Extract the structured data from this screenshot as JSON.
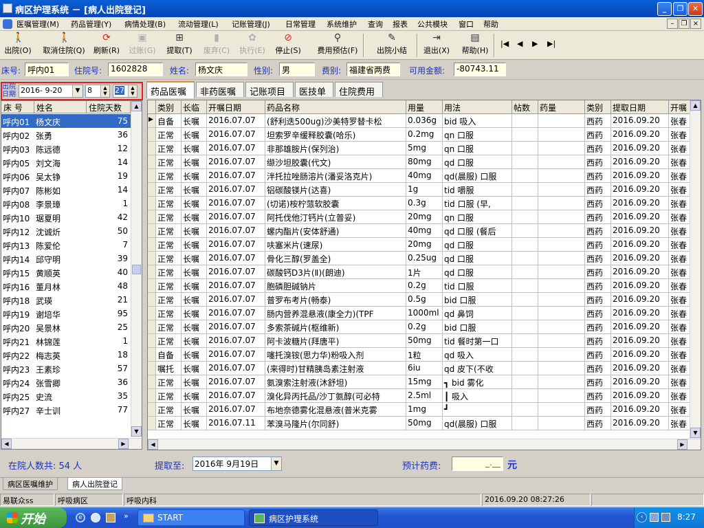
{
  "window": {
    "title": "病区护理系统 － [病人出院登记]",
    "min": "_",
    "restore": "❐",
    "close": "✕"
  },
  "menu": [
    "医嘱管理(M)",
    "药品管理(Y)",
    "病情处理(B)",
    "流动管理(L)",
    "记账管理(J)",
    "日常管理",
    "系统维护",
    "查询",
    "报表",
    "公共模块",
    "窗口",
    "帮助"
  ],
  "mdi": {
    "min": "–",
    "restore": "❐",
    "close": "×"
  },
  "toolbar": [
    {
      "label": "出院(O)",
      "icon": "walk-icon",
      "glyph": "🚶",
      "disabled": false
    },
    {
      "label": "取消住院(Q)",
      "icon": "walk-icon",
      "glyph": "🚶",
      "disabled": false
    },
    {
      "label": "刷新(R)",
      "icon": "refresh-icon",
      "glyph": "⟳",
      "disabled": false
    },
    {
      "label": "过账(G)",
      "icon": "post-icon",
      "glyph": "▣",
      "disabled": true
    },
    {
      "label": "提取(T)",
      "icon": "extract-icon",
      "glyph": "⊞",
      "disabled": false
    },
    {
      "label": "废弃(C)",
      "icon": "trash-icon",
      "glyph": "▮",
      "disabled": true
    },
    {
      "label": "执行(E)",
      "icon": "gear-icon",
      "glyph": "✿",
      "disabled": true
    },
    {
      "label": "停止(S)",
      "icon": "stop-icon",
      "glyph": "⊘",
      "disabled": false
    },
    {
      "label": "费用预估(F)",
      "icon": "search-icon",
      "glyph": "⚲",
      "disabled": false
    },
    {
      "label": "出院小结",
      "icon": "pen-icon",
      "glyph": "✎",
      "disabled": false
    },
    {
      "label": "退出(X)",
      "icon": "exit-icon",
      "glyph": "⇥",
      "disabled": false
    },
    {
      "label": "帮助(H)",
      "icon": "help-book-icon",
      "glyph": "▤",
      "disabled": false
    }
  ],
  "nav": [
    "|◀",
    "◀",
    "▶",
    "▶|"
  ],
  "patient": {
    "bed_label": "床号:",
    "bed": "呼内01",
    "admit_label": "住院号:",
    "admit_no": "1602828",
    "name_label": "姓名:",
    "name": "杨文庆",
    "sex_label": "性别:",
    "sex": "男",
    "fee_label": "费别:",
    "fee_type": "福建省两费",
    "balance_label": "可用金额:",
    "balance": "-80743.11"
  },
  "filter": {
    "label_line1": "出院",
    "label_line2": "日期",
    "date": "2016- 9-20",
    "hour": "8",
    "minute": "27"
  },
  "left_headers": [
    "床 号",
    "姓名",
    "住院天数"
  ],
  "patients": [
    [
      "呼内01",
      "杨文庆",
      "75"
    ],
    [
      "呼内02",
      "张勇",
      "36"
    ],
    [
      "呼内03",
      "陈远德",
      "12"
    ],
    [
      "呼内05",
      "刘文海",
      "14"
    ],
    [
      "呼内06",
      "吴太铮",
      "19"
    ],
    [
      "呼内07",
      "陈彬如",
      "14"
    ],
    [
      "呼内08",
      "李景璋",
      "1"
    ],
    [
      "呼内10",
      "琚夏明",
      "42"
    ],
    [
      "呼内12",
      "沈诚炘",
      "50"
    ],
    [
      "呼内13",
      "陈爱伦",
      "7"
    ],
    [
      "呼内14",
      "邱守明",
      "39"
    ],
    [
      "呼内15",
      "黄顺英",
      "40"
    ],
    [
      "呼内16",
      "董月林",
      "48"
    ],
    [
      "呼内18",
      "武瑛",
      "21"
    ],
    [
      "呼内19",
      "谢培华",
      "95"
    ],
    [
      "呼内20",
      "吴景林",
      "25"
    ],
    [
      "呼内21",
      "林锦莲",
      "1"
    ],
    [
      "呼内22",
      "梅志英",
      "18"
    ],
    [
      "呼内23",
      "王素珍",
      "57"
    ],
    [
      "呼内24",
      "张雪卿",
      "36"
    ],
    [
      "呼内25",
      "史流",
      "35"
    ],
    [
      "呼内27",
      "辛士训",
      "77"
    ]
  ],
  "tabs": [
    "药品医嘱",
    "非药医嘱",
    "记账项目",
    "医技单",
    "住院费用"
  ],
  "grid_headers": [
    "类别",
    "长临",
    "开嘱日期",
    "药品名称",
    "用量",
    "用法",
    "帖数",
    "药量",
    "类别",
    "提取日期",
    "开嘱"
  ],
  "orders": [
    [
      "自备",
      "长嘱",
      "2016.07.07",
      "(舒利迭500ug)沙美特罗替卡松",
      "0.036g",
      "bid 吸入",
      "",
      "",
      "西药",
      "2016.09.20",
      "张春"
    ],
    [
      "正常",
      "长嘱",
      "2016.07.07",
      "坦索罗辛缓释胶囊(哈乐)",
      "0.2mg",
      "qn 口服",
      "",
      "",
      "西药",
      "2016.09.20",
      "张春"
    ],
    [
      "正常",
      "长嘱",
      "2016.07.07",
      "非那雄胺片(保列治)",
      "5mg",
      "qn 口服",
      "",
      "",
      "西药",
      "2016.09.20",
      "张春"
    ],
    [
      "正常",
      "长嘱",
      "2016.07.07",
      "缬沙坦胶囊(代文)",
      "80mg",
      "qd 口服",
      "",
      "",
      "西药",
      "2016.09.20",
      "张春"
    ],
    [
      "正常",
      "长嘱",
      "2016.07.07",
      "泮托拉唑肠溶片(潘妥洛克片)",
      "40mg",
      "qd(晨服) 口服",
      "",
      "",
      "西药",
      "2016.09.20",
      "张春"
    ],
    [
      "正常",
      "长嘱",
      "2016.07.07",
      "铝碳酸镁片(达喜)",
      "1g",
      "tid 嚼服",
      "",
      "",
      "西药",
      "2016.09.20",
      "张春"
    ],
    [
      "正常",
      "长嘱",
      "2016.07.07",
      "(切诺)桉柠蒎软胶囊",
      "0.3g",
      "tid 口服 (早,",
      "",
      "",
      "西药",
      "2016.09.20",
      "张春"
    ],
    [
      "正常",
      "长嘱",
      "2016.07.07",
      "阿托伐他汀钙片(立普妥)",
      "20mg",
      "qn 口服",
      "",
      "",
      "西药",
      "2016.09.20",
      "张春"
    ],
    [
      "正常",
      "长嘱",
      "2016.07.07",
      "螺内酯片(安体舒通)",
      "40mg",
      "qd 口服 (餐后",
      "",
      "",
      "西药",
      "2016.09.20",
      "张春"
    ],
    [
      "正常",
      "长嘱",
      "2016.07.07",
      "呋塞米片(速尿)",
      "20mg",
      "qd 口服",
      "",
      "",
      "西药",
      "2016.09.20",
      "张春"
    ],
    [
      "正常",
      "长嘱",
      "2016.07.07",
      "骨化三醇(罗盖全)",
      "0.25ug",
      "qd 口服",
      "",
      "",
      "西药",
      "2016.09.20",
      "张春"
    ],
    [
      "正常",
      "长嘱",
      "2016.07.07",
      "碳酸钙D3片(Ⅱ)(朗迪)",
      "1片",
      "qd 口服",
      "",
      "",
      "西药",
      "2016.09.20",
      "张春"
    ],
    [
      "正常",
      "长嘱",
      "2016.07.07",
      "胞磷胆碱钠片",
      "0.2g",
      "tid 口服",
      "",
      "",
      "西药",
      "2016.09.20",
      "张春"
    ],
    [
      "正常",
      "长嘱",
      "2016.07.07",
      "普罗布考片(畅泰)",
      "0.5g",
      "bid 口服",
      "",
      "",
      "西药",
      "2016.09.20",
      "张春"
    ],
    [
      "正常",
      "长嘱",
      "2016.07.07",
      "肠内营养混悬液(康全力)(TPF",
      "1000ml",
      "qd 鼻饲",
      "",
      "",
      "西药",
      "2016.09.20",
      "张春"
    ],
    [
      "正常",
      "长嘱",
      "2016.07.07",
      "多索茶碱片(枢维新)",
      "0.2g",
      "bid 口服",
      "",
      "",
      "西药",
      "2016.09.20",
      "张春"
    ],
    [
      "正常",
      "长嘱",
      "2016.07.07",
      "阿卡波糖片(拜唐平)",
      "50mg",
      "tid 餐时第一口",
      "",
      "",
      "西药",
      "2016.09.20",
      "张春"
    ],
    [
      "自备",
      "长嘱",
      "2016.07.07",
      "噻托溴铵(思力华)粉吸入剂",
      "1粒",
      "qd 吸入",
      "",
      "",
      "西药",
      "2016.09.20",
      "张春"
    ],
    [
      "嘱托",
      "长嘱",
      "2016.07.07",
      "(来得时)甘精胰岛素注射液",
      "6iu",
      "qd 皮下(不收",
      "",
      "",
      "西药",
      "2016.09.20",
      "张春"
    ],
    [
      "正常",
      "长嘱",
      "2016.07.07",
      "氨溴索注射液(沐舒坦)",
      "15mg",
      "┓ bid 雾化",
      "",
      "",
      "西药",
      "2016.09.20",
      "张春"
    ],
    [
      "正常",
      "长嘱",
      "2016.07.07",
      "溴化异丙托品/沙丁氨醇(可必特",
      "2.5ml",
      "┃ 吸入",
      "",
      "",
      "西药",
      "2016.09.20",
      "张春"
    ],
    [
      "正常",
      "长嘱",
      "2016.07.07",
      "布地奈德雾化混悬液(普米克雾",
      "1mg",
      "┛",
      "",
      "",
      "西药",
      "2016.09.20",
      "张春"
    ],
    [
      "正常",
      "长嘱",
      "2016.07.11",
      "苯溴马隆片(尔同舒)",
      "50mg",
      "qd(晨服) 口服",
      "",
      "",
      "西药",
      "2016.09.20",
      "张春"
    ]
  ],
  "bottom": {
    "inpatient_count": "在院人数共: 54 人",
    "extract_label": "提取至:",
    "extract_date": "2016年 9月19日",
    "est_label": "预计药费:",
    "est_value": "_.__",
    "unit": "元"
  },
  "sheets": [
    "病区医嘱维护",
    "病人出院登记"
  ],
  "status": [
    "易联众ss",
    "呼吸病区",
    "呼吸内科",
    "",
    "2016.09.20 08:27:26",
    ""
  ],
  "taskbar": {
    "start": "开始",
    "tasks": [
      "START",
      "病区护理系统"
    ],
    "clock": "8:27"
  },
  "colors": {
    "selection": "#316ac5",
    "label_blue": "#1a31c8",
    "highlight_border": "#e02020",
    "field_bg": "#ffffe1"
  }
}
